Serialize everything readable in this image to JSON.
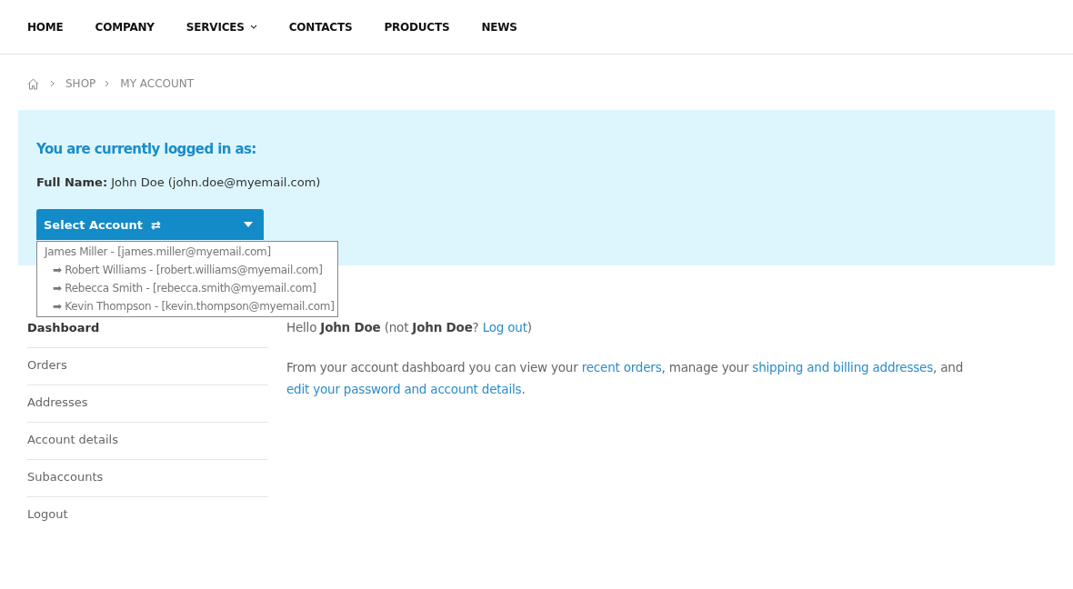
{
  "nav": [
    {
      "label": "HOME",
      "dropdown": false
    },
    {
      "label": "COMPANY",
      "dropdown": false
    },
    {
      "label": "SERVICES",
      "dropdown": true
    },
    {
      "label": "CONTACTS",
      "dropdown": false
    },
    {
      "label": "PRODUCTS",
      "dropdown": false
    },
    {
      "label": "NEWS",
      "dropdown": false
    }
  ],
  "breadcrumb": [
    "SHOP",
    "MY ACCOUNT"
  ],
  "login_panel": {
    "heading": "You are currently logged in as:",
    "full_name": "**Full Name:** John Doe (john.doe@myemail.com)",
    "select": {
      "label": "Select Account",
      "swap_icon": "⇄",
      "expanded": true,
      "options": [
        {
          "text": "James Miller - [james.miller@myemail.com]",
          "children": [
            {
              "marker": "➡",
              "text": "Robert Williams - [robert.williams@myemail.com]"
            },
            {
              "marker": "➡",
              "text": "Rebecca Smith - [rebecca.smith@myemail.com]"
            },
            {
              "marker": "➡",
              "text": "Kevin Thompson - [kevin.thompson@myemail.com]"
            }
          ]
        }
      ]
    }
  },
  "sidebar": [
    {
      "label": "Dashboard",
      "selected": true
    },
    {
      "label": "Orders",
      "selected": false
    },
    {
      "label": "Addresses",
      "selected": false
    },
    {
      "label": "Account details",
      "selected": false
    },
    {
      "label": "Subaccounts",
      "selected": false
    },
    {
      "label": "Logout",
      "selected": false
    }
  ],
  "greeting": [
    {
      "kind": "text",
      "text": "Hello **John Doe** (not **John Doe**? "
    },
    {
      "kind": "link",
      "text": "Log out"
    },
    {
      "kind": "text",
      "text": ")"
    }
  ],
  "intro": [
    {
      "kind": "text",
      "text": "From your account dashboard you can view your "
    },
    {
      "kind": "link",
      "text": "recent orders"
    },
    {
      "kind": "text",
      "text": ", manage your "
    },
    {
      "kind": "link",
      "text": "shipping and billing addresses"
    },
    {
      "kind": "text",
      "text": ", and "
    },
    {
      "kind": "link",
      "text": "edit your password and account details"
    },
    {
      "kind": "text",
      "text": "."
    }
  ]
}
